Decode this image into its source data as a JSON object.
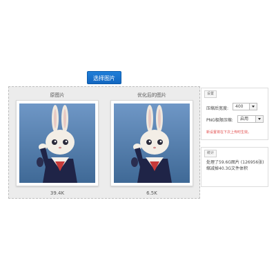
{
  "toolbar": {
    "select_label": "选择图片"
  },
  "compare": {
    "original": {
      "title": "原图片",
      "size": "39.4K"
    },
    "optimized": {
      "title": "优化后的图片",
      "size": "6.5K"
    }
  },
  "settings": {
    "tag": "设置",
    "width_label": "压缩后宽度:",
    "width_value": "400",
    "png_label": "PNG极限压缩:",
    "png_value": "启用",
    "hint": "新设置将在下次上传时生效。"
  },
  "stats": {
    "tag": "统计",
    "text": "处理了59.6G图片 (126956张)\n缩减掉40.3G文件体积"
  },
  "colors": {
    "accent": "#1a73d0",
    "hint": "#e14b4b",
    "photo_bg": "#5b86b6"
  }
}
